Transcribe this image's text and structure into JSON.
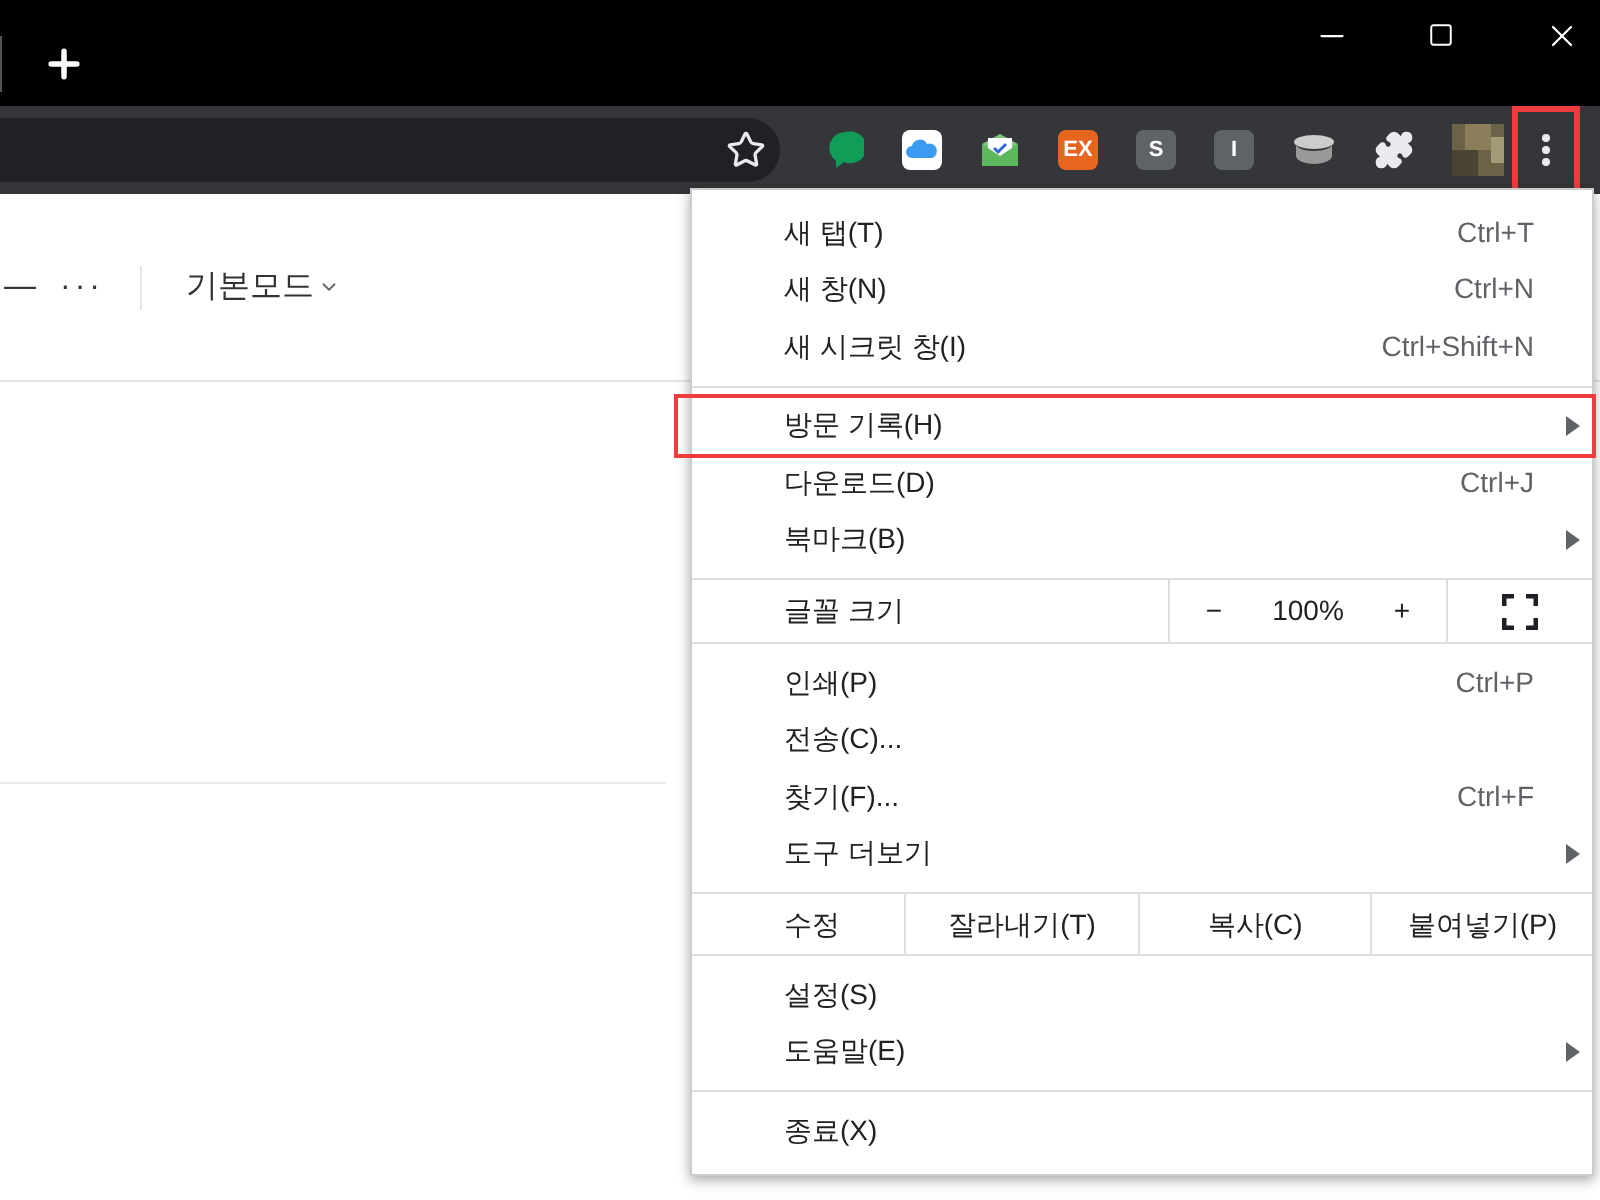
{
  "toolbar": {
    "extensions": [
      {
        "kind": "bubble"
      },
      {
        "kind": "cloud"
      },
      {
        "kind": "mail"
      },
      {
        "kind": "badge",
        "label": "EX",
        "color": "#e8651f"
      },
      {
        "kind": "badge",
        "label": "S",
        "color": "#5f6368"
      },
      {
        "kind": "badge",
        "label": "I",
        "color": "#5f6368"
      },
      {
        "kind": "bowl"
      },
      {
        "kind": "puzzle"
      },
      {
        "kind": "avatar"
      }
    ],
    "menu_button_highlighted": true
  },
  "page": {
    "dash": "—",
    "more": "···",
    "mode": "기본모드"
  },
  "menu": {
    "sections": [
      {
        "kind": "items",
        "items": [
          {
            "label": "새 탭(T)",
            "shortcut": "Ctrl+T",
            "submenu": false,
            "highlighted": false
          },
          {
            "label": "새 창(N)",
            "shortcut": "Ctrl+N",
            "submenu": false,
            "highlighted": false
          },
          {
            "label": "새 시크릿 창(I)",
            "shortcut": "Ctrl+Shift+N",
            "submenu": false,
            "highlighted": false
          }
        ]
      },
      {
        "kind": "items",
        "items": [
          {
            "label": "방문 기록(H)",
            "submenu": true,
            "highlighted": true
          },
          {
            "label": "다운로드(D)",
            "shortcut": "Ctrl+J",
            "submenu": false,
            "highlighted": false
          },
          {
            "label": "북마크(B)",
            "submenu": true,
            "highlighted": false
          }
        ]
      },
      {
        "kind": "zoom",
        "label": "글꼴 크기",
        "minus": "−",
        "value": "100%",
        "plus": "+"
      },
      {
        "kind": "items",
        "items": [
          {
            "label": "인쇄(P)",
            "shortcut": "Ctrl+P",
            "submenu": false,
            "highlighted": false
          },
          {
            "label": "전송(C)...",
            "submenu": false,
            "highlighted": false
          },
          {
            "label": "찾기(F)...",
            "shortcut": "Ctrl+F",
            "submenu": false,
            "highlighted": false
          },
          {
            "label": "도구 더보기",
            "submenu": true,
            "highlighted": false
          }
        ]
      },
      {
        "kind": "edit",
        "label": "수정",
        "actions": [
          "잘라내기(T)",
          "복사(C)",
          "붙여넣기(P)"
        ]
      },
      {
        "kind": "items",
        "items": [
          {
            "label": "설정(S)",
            "submenu": false,
            "highlighted": false
          },
          {
            "label": "도움말(E)",
            "submenu": true,
            "highlighted": false
          }
        ]
      },
      {
        "kind": "items",
        "items": [
          {
            "label": "종료(X)",
            "submenu": false,
            "highlighted": false
          }
        ]
      }
    ]
  }
}
